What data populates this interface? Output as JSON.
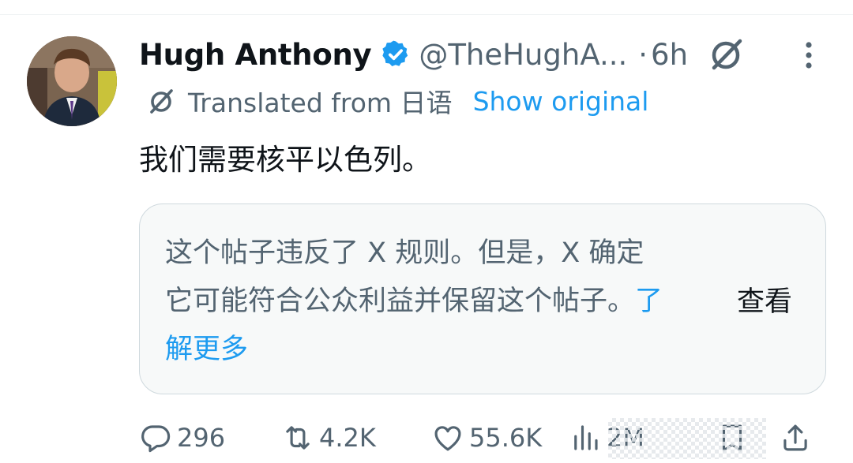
{
  "author": {
    "display_name": "Hugh Anthony",
    "handle": "@TheHughA...",
    "separator": "·",
    "time": "6h"
  },
  "translation": {
    "label": "Translated from 日语",
    "show_original": "Show original"
  },
  "tweet": {
    "text": "我们需要核平以色列。"
  },
  "notice": {
    "text": "这个帖子违反了 X 规则。但是，X 确定它可能符合公众利益并保留这个帖子。",
    "learn_more": "了解更多",
    "view_label": "查看"
  },
  "metrics": {
    "replies": "296",
    "reposts": "4.2K",
    "likes": "55.6K",
    "views": "2M"
  },
  "colors": {
    "accent": "#1d9bf0",
    "muted": "#536471",
    "text": "#0f1419",
    "notice_bg": "#f7f9f9",
    "border": "#cfd9de"
  },
  "icons": {
    "verified": "verified-badge-icon",
    "grok": "grok-icon",
    "more": "more-options-icon",
    "translate": "translate-icon",
    "reply": "reply-icon",
    "repost": "repost-icon",
    "like": "like-icon",
    "views": "views-icon",
    "bookmark": "bookmark-icon",
    "share": "share-icon"
  }
}
